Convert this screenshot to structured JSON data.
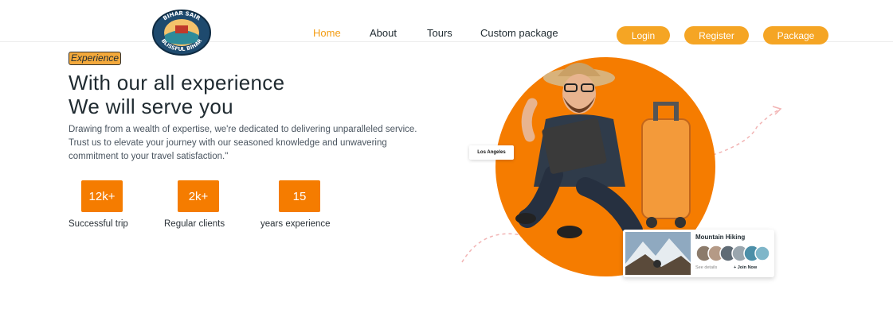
{
  "brand": {
    "logo_text_top": "BIHAR SAIR",
    "logo_text_bottom": "BLISSFUL BIHAR"
  },
  "nav": {
    "links": [
      {
        "label": "Home",
        "active": true
      },
      {
        "label": "About",
        "active": false
      },
      {
        "label": "Tours",
        "active": false
      },
      {
        "label": "Custom package",
        "active": false
      }
    ],
    "buttons": {
      "login": "Login",
      "register": "Register",
      "package": "Package"
    }
  },
  "hero": {
    "tag": "Experience",
    "headline_line1": "With our all experience",
    "headline_line2": "We will serve you",
    "description": "Drawing from a wealth of expertise, we're dedicated to delivering unparalleled service. Trust us to elevate your journey with our seasoned knowledge and unwavering commitment to your travel satisfaction.\"",
    "stats": [
      {
        "value": "12k+",
        "label": "Successful trip"
      },
      {
        "value": "2k+",
        "label": "Regular clients"
      },
      {
        "value": "15",
        "label": "years experience"
      }
    ]
  },
  "cards": {
    "location": "Los Angeles",
    "tour": {
      "title": "Mountain Hiking",
      "see_details": "See details",
      "join": "+ Join Now"
    }
  },
  "colors": {
    "accent": "#f5a524",
    "orange": "#f57c00",
    "nav_active": "#f39c12",
    "text": "#1f2a30"
  }
}
